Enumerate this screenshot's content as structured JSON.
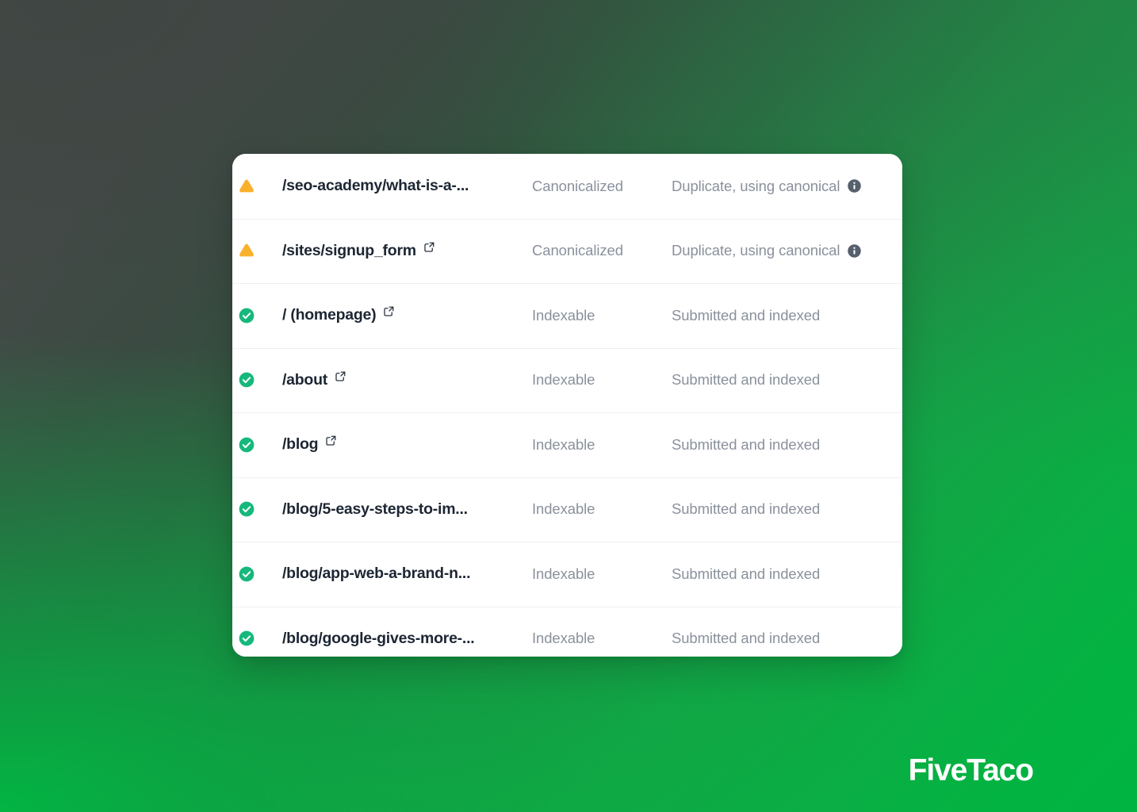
{
  "background": {
    "gradient_from": "#454b48",
    "gradient_mid": "#2a6b42",
    "gradient_to": "#00b441"
  },
  "brand": {
    "name": "FiveTaco",
    "color": "#ffffff"
  },
  "card": {
    "background": "#ffffff",
    "divider_color": "#eef0f2"
  },
  "colors": {
    "warning": "#f9b02b",
    "success": "#16b87c",
    "url_text": "#1d2633",
    "muted_text": "#8a919c",
    "info_badge": "#565f6c"
  },
  "table": {
    "rows": [
      {
        "status_icon": "warning-triangle-icon",
        "url": "/seo-academy/what-is-a-...",
        "has_external_link": false,
        "indexability": "Canonicalized",
        "coverage": "Duplicate, using canonical",
        "has_info": true
      },
      {
        "status_icon": "warning-triangle-icon",
        "url": "/sites/signup_form",
        "has_external_link": true,
        "indexability": "Canonicalized",
        "coverage": "Duplicate, using canonical",
        "has_info": true
      },
      {
        "status_icon": "check-circle-icon",
        "url": "/ (homepage)",
        "has_external_link": true,
        "indexability": "Indexable",
        "coverage": "Submitted and indexed",
        "has_info": false
      },
      {
        "status_icon": "check-circle-icon",
        "url": "/about",
        "has_external_link": true,
        "indexability": "Indexable",
        "coverage": "Submitted and indexed",
        "has_info": false
      },
      {
        "status_icon": "check-circle-icon",
        "url": "/blog",
        "has_external_link": true,
        "indexability": "Indexable",
        "coverage": "Submitted and indexed",
        "has_info": false
      },
      {
        "status_icon": "check-circle-icon",
        "url": "/blog/5-easy-steps-to-im...",
        "has_external_link": false,
        "indexability": "Indexable",
        "coverage": "Submitted and indexed",
        "has_info": false
      },
      {
        "status_icon": "check-circle-icon",
        "url": "/blog/app-web-a-brand-n...",
        "has_external_link": false,
        "indexability": "Indexable",
        "coverage": "Submitted and indexed",
        "has_info": false
      },
      {
        "status_icon": "check-circle-icon",
        "url": "/blog/google-gives-more-...",
        "has_external_link": false,
        "indexability": "Indexable",
        "coverage": "Submitted and indexed",
        "has_info": false
      }
    ]
  }
}
